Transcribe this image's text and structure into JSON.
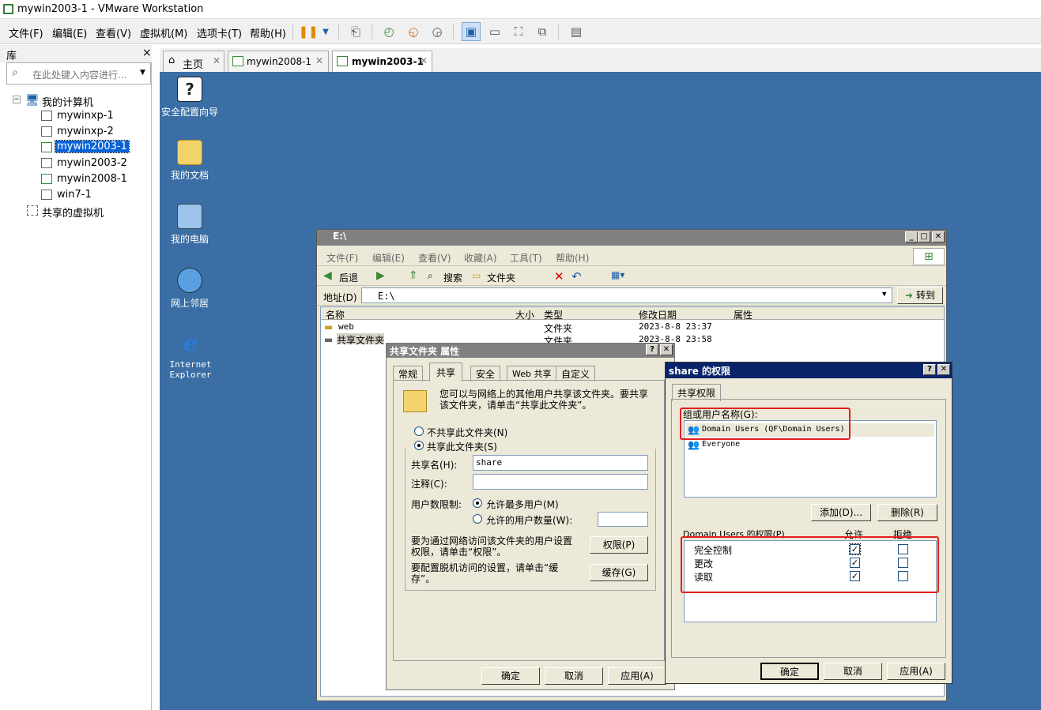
{
  "window": {
    "title": "mywin2003-1 - VMware Workstation"
  },
  "menu": [
    "文件(F)",
    "编辑(E)",
    "查看(V)",
    "虚拟机(M)",
    "选项卡(T)",
    "帮助(H)"
  ],
  "library": {
    "title": "库",
    "close": "×",
    "search_placeholder": "在此处键入内容进行...",
    "root": "我的计算机",
    "vms": [
      "mywinxp-1",
      "mywinxp-2",
      "mywin2003-1",
      "mywin2003-2",
      "mywin2008-1",
      "win7-1"
    ],
    "shared": "共享的虚拟机"
  },
  "tabs": [
    {
      "label": "主页"
    },
    {
      "label": "mywin2008-1"
    },
    {
      "label": "mywin2003-1"
    }
  ],
  "desktop": {
    "icons": [
      "安全配置向导",
      "我的文档",
      "我的电脑",
      "网上邻居",
      "Internet Explorer"
    ]
  },
  "explorer": {
    "title": "E:\\",
    "menu": [
      "文件(F)",
      "编辑(E)",
      "查看(V)",
      "收藏(A)",
      "工具(T)",
      "帮助(H)"
    ],
    "back": "后退",
    "search": "搜索",
    "folders": "文件夹",
    "address_label": "地址(D)",
    "address": "E:\\",
    "go": "转到",
    "columns": [
      "名称",
      "大小",
      "类型",
      "修改日期",
      "属性"
    ],
    "rows": [
      {
        "name": "web",
        "type": "文件夹",
        "date": "2023-8-8 23:37"
      },
      {
        "name": "共享文件夹",
        "type": "文件夹",
        "date": "2023-8-8 23:58"
      }
    ]
  },
  "props": {
    "title": "共享文件夹 属性",
    "tabs": [
      "常规",
      "共享",
      "安全",
      "Web 共享",
      "自定义"
    ],
    "desc": "您可以与网络上的其他用户共享该文件夹。要共享该文件夹，请单击“共享此文件夹”。",
    "no_share": "不共享此文件夹(N)",
    "share": "共享此文件夹(S)",
    "share_name_label": "共享名(H):",
    "share_name": "share",
    "comment_label": "注释(C):",
    "limit_label": "用户数限制:",
    "max_users": "允许最多用户(M)",
    "allowed_users": "允许的用户数量(W):",
    "perm_text": "要为通过网络访问该文件夹的用户设置权限，请单击“权限”。",
    "perm_btn": "权限(P)",
    "cache_text": "要配置脱机访问的设置，请单击“缓存”。",
    "cache_btn": "缓存(G)",
    "ok": "确定",
    "cancel": "取消",
    "apply": "应用(A)"
  },
  "perm": {
    "title": "share 的权限",
    "tab": "共享权限",
    "group_label": "组或用户名称(G):",
    "users": [
      "Domain Users (QF\\Domain Users)",
      "Everyone"
    ],
    "add": "添加(D)...",
    "remove": "删除(R)",
    "perm_label": "Domain Users 的权限(P)",
    "allow": "允许",
    "deny": "拒绝",
    "perms": [
      {
        "name": "完全控制",
        "allow": true,
        "deny": false
      },
      {
        "name": "更改",
        "allow": true,
        "deny": false
      },
      {
        "name": "读取",
        "allow": true,
        "deny": false
      }
    ],
    "ok": "确定",
    "cancel": "取消",
    "apply": "应用(A)"
  }
}
